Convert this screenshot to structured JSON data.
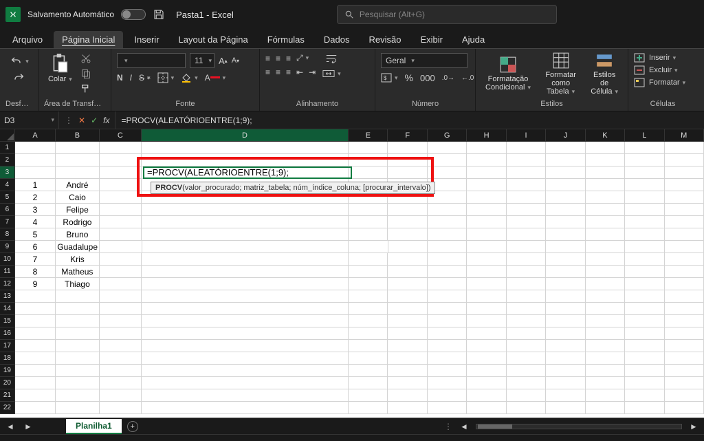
{
  "titlebar": {
    "autosave_label": "Salvamento Automático",
    "file_name": "Pasta1  -  Excel",
    "search_placeholder": "Pesquisar (Alt+G)"
  },
  "tabs": {
    "file": "Arquivo",
    "home": "Página Inicial",
    "insert": "Inserir",
    "page_layout": "Layout da Página",
    "formulas": "Fórmulas",
    "data": "Dados",
    "review": "Revisão",
    "view": "Exibir",
    "help": "Ajuda"
  },
  "ribbon": {
    "undo_group": "Desfazer",
    "clipboard_group": "Área de Transferên...",
    "paste_label": "Colar",
    "font_group": "Fonte",
    "font_size": "11",
    "alignment_group": "Alinhamento",
    "number_group": "Número",
    "number_format": "Geral",
    "styles_group": "Estilos",
    "cond_fmt": "Formatação Condicional",
    "fmt_table": "Formatar como Tabela",
    "cell_styles": "Estilos de Célula",
    "cells_group": "Células",
    "insert_btn": "Inserir",
    "delete_btn": "Excluir",
    "format_btn": "Formatar",
    "bold": "N",
    "italic": "I",
    "underline": "S"
  },
  "formula_bar": {
    "name_box": "D3",
    "formula": "=PROCV(ALEATÓRIOENTRE(1;9);"
  },
  "columns": [
    "A",
    "B",
    "C",
    "D",
    "E",
    "F",
    "G",
    "H",
    "I",
    "J",
    "K",
    "L",
    "M"
  ],
  "rows": [
    "1",
    "2",
    "3",
    "4",
    "5",
    "6",
    "7",
    "8",
    "9",
    "10",
    "11",
    "12",
    "13",
    "14",
    "15",
    "16",
    "17",
    "18",
    "19",
    "20",
    "21",
    "22"
  ],
  "sheet_data": {
    "A": [
      "",
      "",
      "",
      "1",
      "2",
      "3",
      "4",
      "5",
      "6",
      "7",
      "8",
      "9",
      "",
      "",
      "",
      "",
      "",
      "",
      "",
      "",
      "",
      ""
    ],
    "B": [
      "",
      "",
      "",
      "André",
      "Caio",
      "Felipe",
      "Rodrigo",
      "Bruno",
      "Guadalupe",
      "Kris",
      "Matheus",
      "Thiago",
      "",
      "",
      "",
      "",
      "",
      "",
      "",
      "",
      "",
      ""
    ]
  },
  "active_cell": {
    "display_text": "=PROCV(ALEATÓRIOENTRE(1;9);",
    "tooltip_func": "PROCV",
    "tooltip_args": "(valor_procurado; matriz_tabela; núm_índice_coluna; [procurar_intervalo])"
  },
  "sheet_tabs": {
    "sheet1": "Planilha1"
  }
}
